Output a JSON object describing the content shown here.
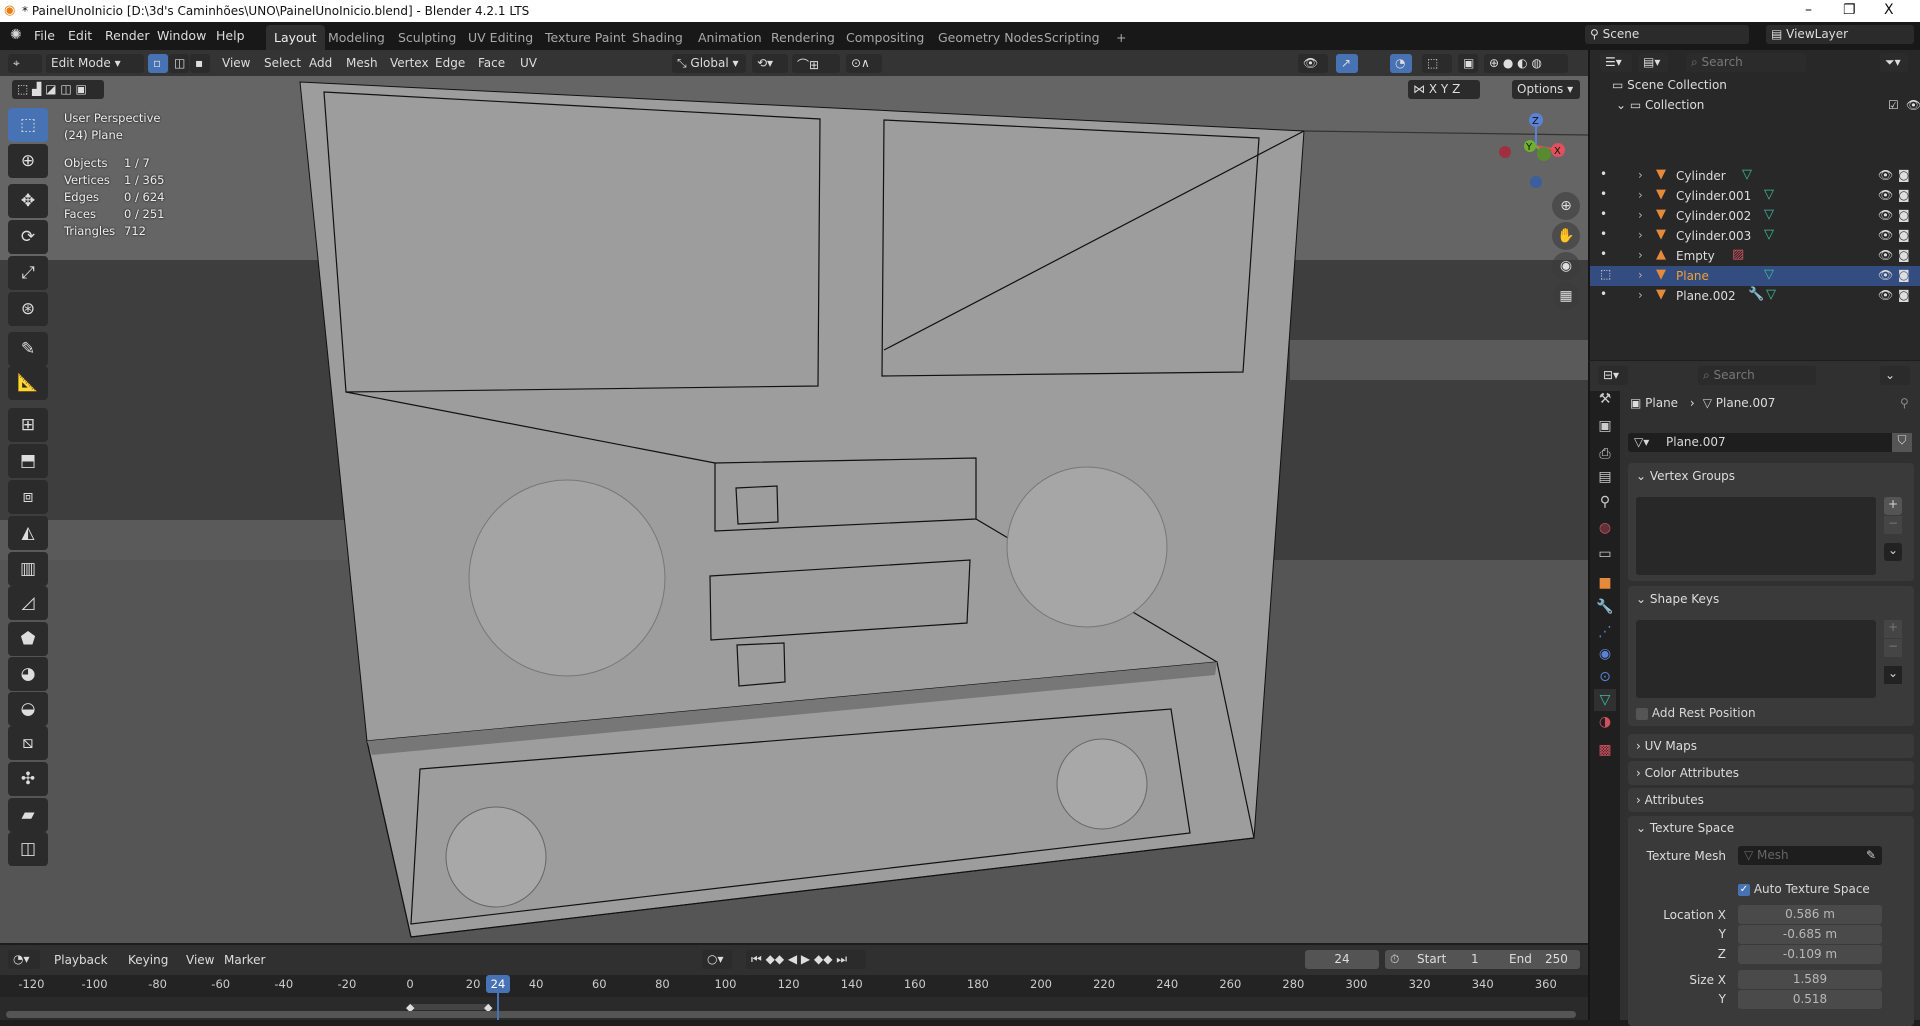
{
  "window": {
    "title": "* PainelUnoInicio [D:\\3d's Caminhões\\UNO\\PainelUnoInicio.blend] - Blender 4.2.1 LTS",
    "minimize": "–",
    "maximize": "❐",
    "close": "X"
  },
  "menu": [
    "File",
    "Edit",
    "Render",
    "Window",
    "Help"
  ],
  "workspaces": [
    "Layout",
    "Modeling",
    "Sculpting",
    "UV Editing",
    "Texture Paint",
    "Shading",
    "Animation",
    "Rendering",
    "Compositing",
    "Geometry Nodes",
    "Scripting",
    "+"
  ],
  "active_workspace": "Layout",
  "scene": {
    "name": "Scene",
    "view_layer": "ViewLayer"
  },
  "viewport_header": {
    "mode": "Edit Mode",
    "menus": [
      "View",
      "Select",
      "Add",
      "Mesh",
      "Vertex",
      "Edge",
      "Face",
      "UV"
    ],
    "orientation": "Global",
    "options": "Options",
    "axes": [
      "X",
      "Y",
      "Z"
    ]
  },
  "overlay": {
    "view": "User Perspective",
    "object": "(24) Plane",
    "stats": [
      {
        "label": "Objects",
        "value": "1 / 7"
      },
      {
        "label": "Vertices",
        "value": "1 / 365"
      },
      {
        "label": "Edges",
        "value": "0 / 624"
      },
      {
        "label": "Faces",
        "value": "0 / 251"
      },
      {
        "label": "Triangles",
        "value": "712"
      }
    ]
  },
  "gizmo": {
    "x": "X",
    "y": "Y",
    "z": "Z"
  },
  "outliner": {
    "search_placeholder": "Search",
    "scene_collection": "Scene Collection",
    "collection": "Collection",
    "items": [
      {
        "name": "Cylinder",
        "data": "mesh"
      },
      {
        "name": "Cylinder.001",
        "data": "mesh"
      },
      {
        "name": "Cylinder.002",
        "data": "mesh"
      },
      {
        "name": "Cylinder.003",
        "data": "mesh"
      },
      {
        "name": "Empty",
        "data": "image"
      },
      {
        "name": "Plane",
        "data": "mesh",
        "selected": true
      },
      {
        "name": "Plane.002",
        "data": "modifier+mesh"
      }
    ]
  },
  "properties": {
    "search_placeholder": "Search",
    "breadcrumb_object": "Plane",
    "breadcrumb_mesh": "Plane.007",
    "mesh_name": "Plane.007",
    "panels": {
      "vertex_groups": "Vertex Groups",
      "shape_keys": "Shape Keys",
      "add_rest_position": "Add Rest Position",
      "uv_maps": "UV Maps",
      "color_attributes": "Color Attributes",
      "attributes": "Attributes",
      "texture_space": "Texture Space"
    },
    "texture_mesh_label": "Texture Mesh",
    "texture_mesh_placeholder": "Mesh",
    "auto_texture_space": "Auto Texture Space",
    "auto_texture_space_checked": true,
    "location_label": "Location X",
    "location": {
      "x": "0.586 m",
      "y": "-0.685 m",
      "z": "-0.109 m"
    },
    "size_label": "Size X",
    "size": {
      "x": "1.589",
      "y": "0.518"
    },
    "y_label": "Y",
    "z_label": "Z"
  },
  "timeline": {
    "menus": [
      "Playback",
      "Keying",
      "View",
      "Marker"
    ],
    "current_frame": "24",
    "start_label": "Start",
    "start": "1",
    "end_label": "End",
    "end": "250",
    "ruler": [
      -120,
      -100,
      -80,
      -60,
      -40,
      -20,
      0,
      20,
      40,
      60,
      80,
      100,
      120,
      140,
      160,
      180,
      200,
      220,
      240,
      260,
      280,
      300,
      320,
      340,
      360
    ]
  },
  "colors": {
    "accent": "#4772b3",
    "selected_row": "#334d80",
    "object_orange": "#e48a3a",
    "mesh_green": "#3bbf9a"
  }
}
